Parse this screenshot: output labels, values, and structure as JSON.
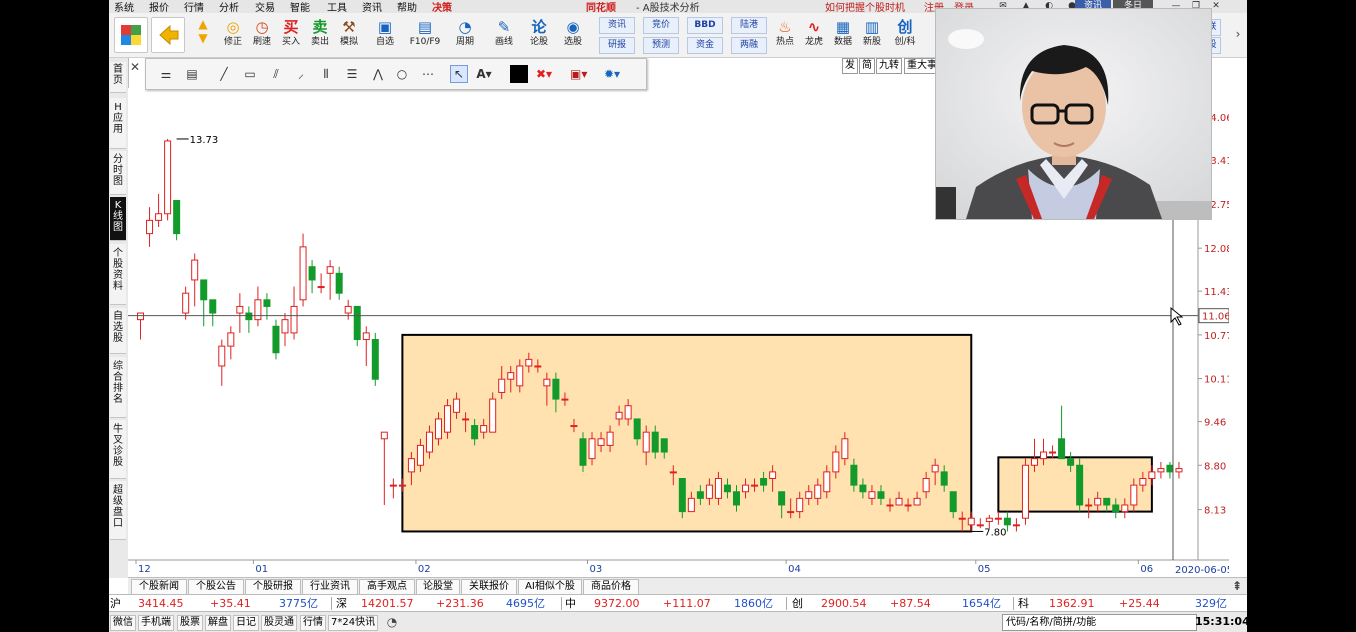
{
  "menu": {
    "items": [
      "系统",
      "报价",
      "行情",
      "分析",
      "交易",
      "智能",
      "工具",
      "资讯",
      "帮助",
      "决策"
    ],
    "brand": "同花顺",
    "app_title": "- A股技术分析",
    "tip": "如何把握个股时机",
    "register": "注册",
    "login": "登录",
    "right_badges": [
      "资讯",
      "冬日"
    ]
  },
  "toolbar": {
    "buttons": [
      {
        "label": "修正",
        "icon": "fix-icon"
      },
      {
        "label": "刷速",
        "icon": "refresh-icon"
      },
      {
        "label": "买入",
        "icon": "buy-icon",
        "glyph": "买"
      },
      {
        "label": "卖出",
        "icon": "sell-icon",
        "glyph": "卖"
      },
      {
        "label": "模拟",
        "icon": "simulate-icon"
      },
      {
        "label": "自选",
        "icon": "watchlist-icon"
      },
      {
        "label": "F10/F9",
        "icon": "f10-icon"
      },
      {
        "label": "周期",
        "icon": "period-icon"
      },
      {
        "label": "画线",
        "icon": "draw-icon"
      },
      {
        "label": "论股",
        "icon": "discuss-icon",
        "glyph": "论"
      },
      {
        "label": "选股",
        "icon": "pick-stock-icon"
      }
    ],
    "boxes": [
      [
        "资讯",
        "研报"
      ],
      [
        "竞价",
        "预测"
      ],
      [
        "BBD",
        "资金"
      ],
      [
        "陆港",
        "两融"
      ]
    ],
    "right_buttons": [
      {
        "label": "热点",
        "icon": "hot-icon"
      },
      {
        "label": "龙虎",
        "icon": "dragon-icon"
      },
      {
        "label": "数据",
        "icon": "data-icon"
      },
      {
        "label": "新股",
        "icon": "new-stock-icon"
      },
      {
        "label": "创/科",
        "icon": "growth-icon",
        "glyph": "创"
      }
    ],
    "far_right": [
      "联",
      "股"
    ]
  },
  "left_tabs": [
    {
      "label": "首页",
      "active": false
    },
    {
      "label": "H应用",
      "active": false
    },
    {
      "label": "分时图",
      "active": false
    },
    {
      "label": "K线图",
      "active": true
    },
    {
      "label": "个股资料",
      "active": false
    },
    {
      "label": "自选股",
      "active": false
    },
    {
      "label": "综合排名",
      "active": false
    },
    {
      "label": "牛叉诊股",
      "active": false
    },
    {
      "label": "超级盘口",
      "active": false
    }
  ],
  "tag_strip": [
    "发",
    "简",
    "九转",
    "重大事"
  ],
  "chart_data": {
    "type": "candlestick",
    "x_ticks": [
      {
        "label": "12",
        "pos": 0
      },
      {
        "label": "01",
        "pos": 13
      },
      {
        "label": "02",
        "pos": 31
      },
      {
        "label": "03",
        "pos": 50
      },
      {
        "label": "04",
        "pos": 72
      },
      {
        "label": "05",
        "pos": 93
      },
      {
        "label": "06",
        "pos": 111
      }
    ],
    "last_date": "2020-06-05 五",
    "y_ticks": [
      14.06,
      13.41,
      12.75,
      12.08,
      11.43,
      10.77,
      10.11,
      9.46,
      8.8,
      8.13
    ],
    "crosshair_price": "11.06",
    "ylim": [
      7.55,
      14.5
    ],
    "annotations": [
      {
        "label": "13.73",
        "pos": 4,
        "price": 13.73
      },
      {
        "label": "7.80",
        "pos": 92,
        "price": 7.8
      }
    ],
    "highlight_boxes": [
      {
        "from": 29.5,
        "to": 92.5,
        "low": 7.8,
        "high": 10.77
      },
      {
        "from": 95.5,
        "to": 112.5,
        "low": 8.1,
        "high": 8.92
      }
    ],
    "candles": [
      [
        11.0,
        11.1,
        11.1,
        10.7
      ],
      [
        12.3,
        12.5,
        12.7,
        12.1
      ],
      [
        12.5,
        12.6,
        12.9,
        12.4
      ],
      [
        12.6,
        13.7,
        13.73,
        12.5
      ],
      [
        12.8,
        12.3,
        12.8,
        12.2
      ],
      [
        11.1,
        11.4,
        11.5,
        11.0
      ],
      [
        11.6,
        11.9,
        12.0,
        11.2
      ],
      [
        11.6,
        11.3,
        11.6,
        10.9
      ],
      [
        11.3,
        11.1,
        11.3,
        10.9
      ],
      [
        10.3,
        10.6,
        10.7,
        10.0
      ],
      [
        10.6,
        10.8,
        10.9,
        10.4
      ],
      [
        11.1,
        11.2,
        11.4,
        10.8
      ],
      [
        11.1,
        11.0,
        11.2,
        10.8
      ],
      [
        11.0,
        11.3,
        11.5,
        10.9
      ],
      [
        11.3,
        11.2,
        11.4,
        11.0
      ],
      [
        10.9,
        10.5,
        11.0,
        10.4
      ],
      [
        10.8,
        11.0,
        11.1,
        10.6
      ],
      [
        10.8,
        11.2,
        11.5,
        10.7
      ],
      [
        11.3,
        12.1,
        12.3,
        11.2
      ],
      [
        11.8,
        11.6,
        11.9,
        11.4
      ],
      [
        11.5,
        11.5,
        11.7,
        11.4
      ],
      [
        11.7,
        11.8,
        11.9,
        11.3
      ],
      [
        11.7,
        11.4,
        11.8,
        11.3
      ],
      [
        11.1,
        11.2,
        11.3,
        11.0
      ],
      [
        11.2,
        10.7,
        11.2,
        10.6
      ],
      [
        10.7,
        10.8,
        10.9,
        10.3
      ],
      [
        10.7,
        10.1,
        10.8,
        10.0
      ],
      [
        9.2,
        9.3,
        9.3,
        8.2
      ],
      [
        8.5,
        8.5,
        8.6,
        8.3
      ],
      [
        8.5,
        8.5,
        8.6,
        8.4
      ],
      [
        8.7,
        8.9,
        9.0,
        8.5
      ],
      [
        8.8,
        9.1,
        9.2,
        8.7
      ],
      [
        9.0,
        9.3,
        9.4,
        8.9
      ],
      [
        9.2,
        9.5,
        9.6,
        9.1
      ],
      [
        9.3,
        9.7,
        9.8,
        9.2
      ],
      [
        9.6,
        9.8,
        9.9,
        9.5
      ],
      [
        9.5,
        9.5,
        9.6,
        9.3
      ],
      [
        9.4,
        9.2,
        9.5,
        9.1
      ],
      [
        9.3,
        9.4,
        9.5,
        9.2
      ],
      [
        9.3,
        9.8,
        9.9,
        9.3
      ],
      [
        9.9,
        10.1,
        10.3,
        9.8
      ],
      [
        10.1,
        10.2,
        10.3,
        9.9
      ],
      [
        10.0,
        10.3,
        10.4,
        9.9
      ],
      [
        10.3,
        10.4,
        10.5,
        10.2
      ],
      [
        10.3,
        10.3,
        10.4,
        10.2
      ],
      [
        10.0,
        10.1,
        10.2,
        9.7
      ],
      [
        10.1,
        9.8,
        10.2,
        9.6
      ],
      [
        9.8,
        9.8,
        9.9,
        9.7
      ],
      [
        9.4,
        9.4,
        9.5,
        9.3
      ],
      [
        9.2,
        8.8,
        9.3,
        8.7
      ],
      [
        8.9,
        9.2,
        9.3,
        8.8
      ],
      [
        9.1,
        9.2,
        9.3,
        9.0
      ],
      [
        9.1,
        9.3,
        9.4,
        9.0
      ],
      [
        9.5,
        9.6,
        9.7,
        9.4
      ],
      [
        9.5,
        9.7,
        9.8,
        9.4
      ],
      [
        9.5,
        9.2,
        9.5,
        9.1
      ],
      [
        9.0,
        9.3,
        9.4,
        8.8
      ],
      [
        9.3,
        9.0,
        9.4,
        8.9
      ],
      [
        9.2,
        9.0,
        9.2,
        8.9
      ],
      [
        8.7,
        8.7,
        8.8,
        8.5
      ],
      [
        8.6,
        8.1,
        8.6,
        8.0
      ],
      [
        8.1,
        8.3,
        8.4,
        8.1
      ],
      [
        8.4,
        8.3,
        8.5,
        8.2
      ],
      [
        8.3,
        8.5,
        8.6,
        8.2
      ],
      [
        8.3,
        8.6,
        8.7,
        8.2
      ],
      [
        8.5,
        8.4,
        8.6,
        8.3
      ],
      [
        8.4,
        8.2,
        8.5,
        8.1
      ],
      [
        8.4,
        8.5,
        8.6,
        8.3
      ],
      [
        8.5,
        8.5,
        8.6,
        8.4
      ],
      [
        8.6,
        8.5,
        8.7,
        8.4
      ],
      [
        8.6,
        8.7,
        8.8,
        8.4
      ],
      [
        8.4,
        8.2,
        8.4,
        8.0
      ],
      [
        8.1,
        8.1,
        8.3,
        8.0
      ],
      [
        8.1,
        8.3,
        8.4,
        8.0
      ],
      [
        8.3,
        8.4,
        8.5,
        8.2
      ],
      [
        8.3,
        8.5,
        8.6,
        8.2
      ],
      [
        8.4,
        8.7,
        8.8,
        8.3
      ],
      [
        8.7,
        9.0,
        9.1,
        8.6
      ],
      [
        8.9,
        9.2,
        9.3,
        8.8
      ],
      [
        8.8,
        8.5,
        8.9,
        8.4
      ],
      [
        8.5,
        8.4,
        8.6,
        8.3
      ],
      [
        8.3,
        8.4,
        8.5,
        8.2
      ],
      [
        8.4,
        8.3,
        8.5,
        8.2
      ],
      [
        8.2,
        8.2,
        8.3,
        8.1
      ],
      [
        8.2,
        8.3,
        8.4,
        8.2
      ],
      [
        8.2,
        8.2,
        8.3,
        8.1
      ],
      [
        8.2,
        8.3,
        8.4,
        8.2
      ],
      [
        8.4,
        8.6,
        8.7,
        8.3
      ],
      [
        8.7,
        8.8,
        8.9,
        8.5
      ],
      [
        8.7,
        8.5,
        8.8,
        8.4
      ],
      [
        8.4,
        8.1,
        8.4,
        8.0
      ],
      [
        8.0,
        8.0,
        8.1,
        7.8
      ],
      [
        7.9,
        8.0,
        8.1,
        7.8
      ],
      [
        7.9,
        7.9,
        8.0,
        7.85
      ],
      [
        7.95,
        8.0,
        8.05,
        7.85
      ],
      [
        8.0,
        8.0,
        8.1,
        7.9
      ],
      [
        8.0,
        7.9,
        8.1,
        7.8
      ],
      [
        7.9,
        7.9,
        8.0,
        7.8
      ],
      [
        8.0,
        8.8,
        8.9,
        7.9
      ],
      [
        8.8,
        8.9,
        9.2,
        8.7
      ],
      [
        8.9,
        9.0,
        9.2,
        8.8
      ],
      [
        9.0,
        9.0,
        9.1,
        8.9
      ],
      [
        9.2,
        8.9,
        9.7,
        8.9
      ],
      [
        8.9,
        8.8,
        9.0,
        8.7
      ],
      [
        8.8,
        8.2,
        8.9,
        8.1
      ],
      [
        8.2,
        8.2,
        8.3,
        8.0
      ],
      [
        8.2,
        8.3,
        8.4,
        8.1
      ],
      [
        8.3,
        8.2,
        8.3,
        8.1
      ],
      [
        8.2,
        8.1,
        8.3,
        8.0
      ],
      [
        8.1,
        8.2,
        8.3,
        8.0
      ],
      [
        8.2,
        8.5,
        8.6,
        8.1
      ],
      [
        8.5,
        8.6,
        8.7,
        8.4
      ],
      [
        8.6,
        8.7,
        8.8,
        8.5
      ],
      [
        8.7,
        8.75,
        8.85,
        8.6
      ],
      [
        8.8,
        8.7,
        8.85,
        8.6
      ],
      [
        8.7,
        8.75,
        8.85,
        8.6
      ]
    ]
  },
  "info_tabs": [
    "个股新闻",
    "个股公告",
    "个股研报",
    "行业资讯",
    "高手观点",
    "论股堂",
    "关联报价",
    "AI相似个股",
    "商品价格"
  ],
  "ticker": [
    {
      "name": "沪",
      "value": "3414.45",
      "change": "+35.41",
      "amount": "3775亿"
    },
    {
      "name": "深",
      "value": "14201.57",
      "change": "+231.36",
      "amount": "4695亿"
    },
    {
      "name": "中",
      "value": "9372.00",
      "change": "+111.07",
      "amount": "1860亿"
    },
    {
      "name": "创",
      "value": "2900.54",
      "change": "+87.54",
      "amount": "1654亿"
    },
    {
      "name": "科",
      "value": "1362.91",
      "change": "+25.44",
      "amount": "329亿"
    }
  ],
  "status": {
    "items": [
      "微信",
      "手机端",
      "股票",
      "解盘",
      "日记",
      "股灵通",
      "行情",
      "7*24快讯"
    ],
    "code_box": "代码/名称/简拼/功能",
    "time": "15:31:04"
  },
  "colors": {
    "up": "#e02020",
    "down": "#129a2a",
    "highlight_fill": "#ffe2b0",
    "ticker_blue": "#2050c8"
  }
}
